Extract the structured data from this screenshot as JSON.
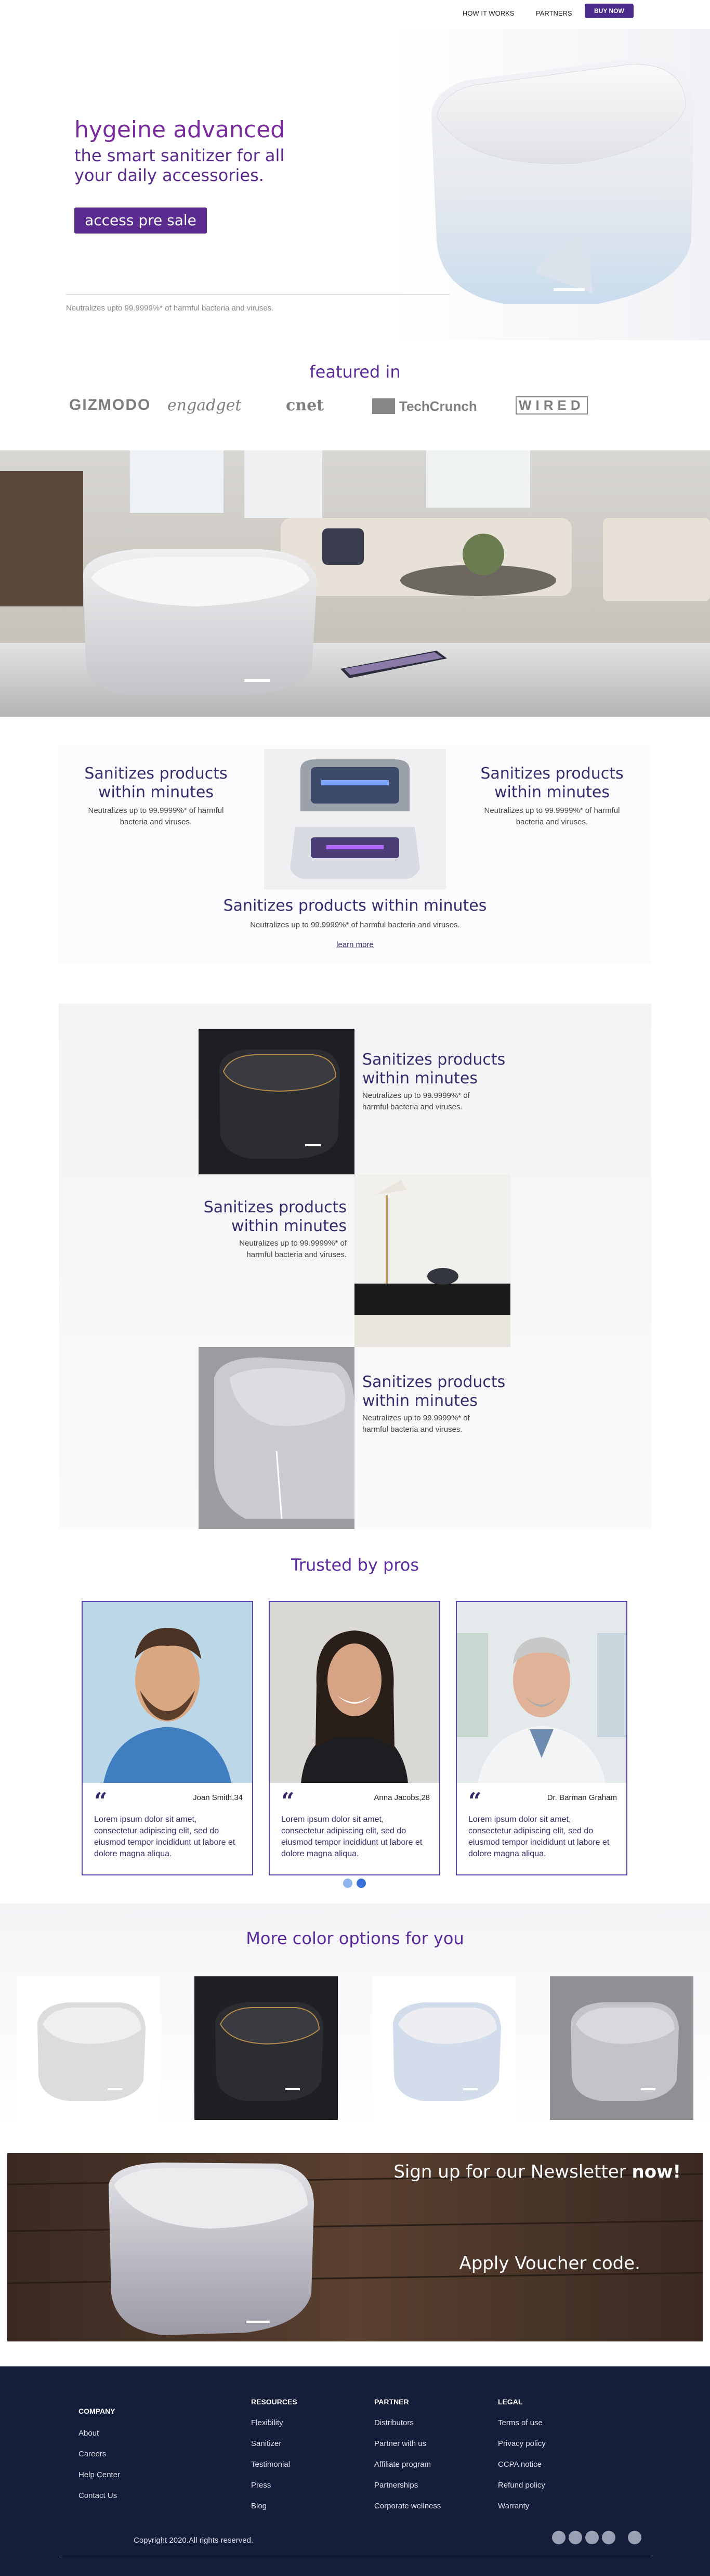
{
  "nav": {
    "links": [
      "HOW IT WORKS",
      "PARTNERS"
    ],
    "buy": "BUY NOW"
  },
  "hero": {
    "title": "hygeine advanced",
    "subtitle": "the smart sanitizer for all your daily accessories.",
    "cta": "access pre sale",
    "note": "Neutralizes upto 99.9999%* of harmful bacteria and viruses."
  },
  "featured": {
    "title": "featured in",
    "logos": [
      "GIZMODO",
      "engadget",
      "cnet",
      "TechCrunch",
      "WIRED"
    ]
  },
  "features": {
    "left": {
      "h": "Sanitizes products within minutes",
      "p": "Neutralizes up to 99.9999%* of harmful bacteria and viruses."
    },
    "right": {
      "h": "Sanitizes products within minutes",
      "p": "Neutralizes up to 99.9999%* of harmful bacteria and viruses."
    },
    "center": {
      "h": "Sanitizes products within minutes",
      "p": "Neutralizes up to 99.9999%* of harmful bacteria and viruses."
    },
    "learn": "learn more"
  },
  "alt": [
    {
      "h": "Sanitizes products within minutes",
      "p": "Neutralizes up to 99.9999%* of harmful bacteria and viruses."
    },
    {
      "h": "Sanitizes products within minutes",
      "p": "Neutralizes up to 99.9999%* of harmful bacteria and viruses."
    },
    {
      "h": "Sanitizes products within minutes",
      "p": "Neutralizes up to 99.9999%* of harmful bacteria and viruses."
    }
  ],
  "trusted": {
    "title": "Trusted by pros",
    "cards": [
      {
        "name": "Joan Smith,34",
        "text": "Lorem ipsum dolor sit amet, consectetur adipiscing elit, sed do eiusmod tempor incididunt ut labore et dolore magna aliqua."
      },
      {
        "name": "Anna Jacobs,28",
        "text": "Lorem ipsum dolor sit amet, consectetur adipiscing elit, sed do eiusmod tempor incididunt ut labore et dolore magna aliqua."
      },
      {
        "name": "Dr. Barman Graham",
        "text": "Lorem ipsum dolor sit amet, consectetur adipiscing elit, sed do eiusmod tempor incididunt ut labore et dolore magna aliqua."
      }
    ]
  },
  "colors": {
    "title": "More color options for you"
  },
  "newsletter": {
    "heading": "Sign up for our Newsletter ",
    "heading_bold": "now!",
    "voucher": "Apply Voucher code."
  },
  "footer": {
    "company": {
      "title": "COMPANY",
      "links": [
        "About",
        "Careers",
        "Help Center",
        "Contact Us"
      ]
    },
    "resources": {
      "title": "RESOURCES",
      "links": [
        "Flexibility",
        "Sanitizer",
        "Testimonial",
        "Press",
        "Blog"
      ]
    },
    "partner": {
      "title": "PARTNER",
      "links": [
        "Distributors",
        "Partner with us",
        "Affiliate program",
        "Partnerships",
        "Corporate wellness"
      ]
    },
    "legal": {
      "title": "LEGAL",
      "links": [
        "Terms of use",
        "Privacy policy",
        "CCPA notice",
        "Refund policy",
        "Warranty"
      ]
    },
    "copyright": "Copyright 2020.All rights reserved."
  }
}
